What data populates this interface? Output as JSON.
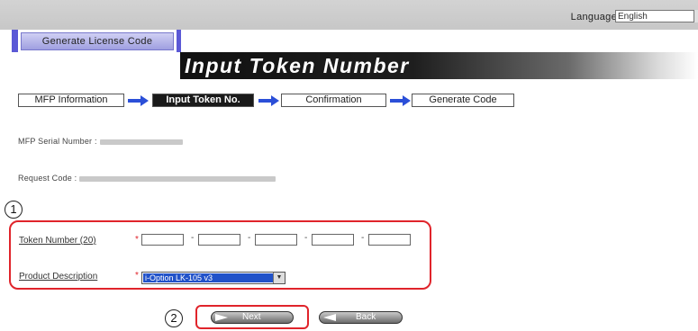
{
  "header": {
    "language_label": "Language",
    "language_value": "English",
    "tab_label": "Generate License Code",
    "banner_title": "Input Token Number"
  },
  "steps": [
    {
      "label": "MFP Information",
      "active": false
    },
    {
      "label": "Input Token No.",
      "active": true
    },
    {
      "label": "Confirmation",
      "active": false
    },
    {
      "label": "Generate Code",
      "active": false
    }
  ],
  "info": {
    "serial_label": "MFP Serial Number :",
    "request_label": "Request Code :"
  },
  "callouts": {
    "one": "1",
    "two": "2"
  },
  "form": {
    "token_label": "Token Number (20)",
    "product_label": "Product Description",
    "required_mark": "*",
    "separator": "-",
    "product_value": "i-Option LK-105 v3"
  },
  "buttons": {
    "next": "Next",
    "back": "Back"
  },
  "colors": {
    "accent_red": "#e0242b",
    "step_arrow": "#2b4fd8",
    "tab_purple": "#5b59d6"
  }
}
